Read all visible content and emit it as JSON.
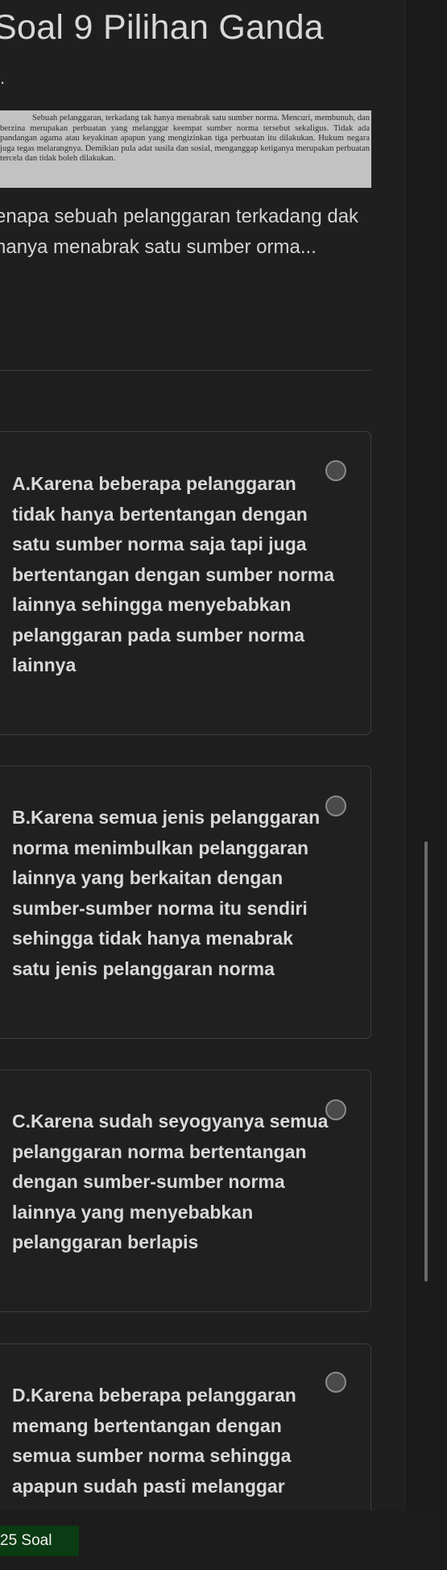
{
  "header": {
    "title": "Soal 9 Pilihan Ganda",
    "subtitle": "."
  },
  "passage": {
    "text": "Sebuah pelanggaran, terkadang tak hanya menabrak satu sumber norma. Mencuri, membunuh, dan berzina merupakan perbuatan yang melanggar keempat sumber norma tersebut sekaligus. Tidak ada pandangan agama atau keyakinan apapun yang mengizinkan tiga perbuatan itu dilakukan. Hukum negara juga tegas melarangnya. Demikian pula adat susila dan sosial, menganggap ketiganya merupakan perbuatan tercela dan tidak boleh dilakukan."
  },
  "question": {
    "text": "enapa sebuah pelanggaran terkadang dak hanya menabrak satu sumber orma..."
  },
  "options": [
    {
      "label": "A.Karena beberapa pelanggaran tidak hanya bertentangan dengan satu sumber norma saja tapi juga bertentangan dengan sumber norma lainnya sehingga menyebabkan pelanggaran pada sumber norma lainnya",
      "selected": false
    },
    {
      "label": "B.Karena semua jenis pelanggaran norma menimbulkan pelanggaran lainnya yang berkaitan dengan sumber-sumber norma itu sendiri sehingga tidak hanya menabrak satu jenis pelanggaran norma",
      "selected": false
    },
    {
      "label": "C.Karena sudah seyogyanya semua pelanggaran norma bertentangan dengan sumber-sumber norma lainnya yang menyebabkan pelanggaran berlapis",
      "selected": false
    },
    {
      "label": "D.Karena beberapa pelanggaran memang bertentangan dengan semua sumber norma sehingga apapun sudah pasti melanggar",
      "selected": false
    }
  ],
  "footer": {
    "count_label": "25 Soal"
  },
  "colors": {
    "background": "#1f1f1f",
    "card_border": "#3d3d3d",
    "badge": "#0b3b12",
    "passage_bg": "#c2c2c2"
  }
}
